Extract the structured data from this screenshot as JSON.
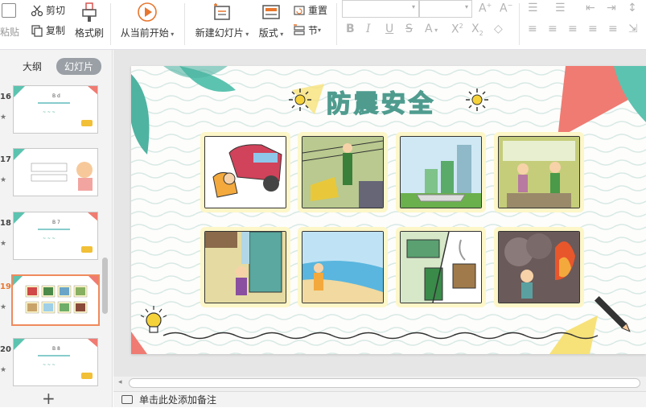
{
  "ribbon": {
    "paste_label": "粘贴",
    "cut_label": "剪切",
    "copy_label": "复制",
    "format_painter_label": "格式刷",
    "play_from_current_label": "从当前开始",
    "new_slide_label": "新建幻灯片",
    "layout_label": "版式",
    "reset_label": "重置",
    "section_label": "节"
  },
  "left_panel": {
    "tabs": [
      {
        "label": "大纲"
      },
      {
        "label": "幻灯片"
      }
    ],
    "slides": [
      {
        "number": "16",
        "star": "★"
      },
      {
        "number": "17",
        "star": "★"
      },
      {
        "number": "18",
        "star": "★"
      },
      {
        "number": "19",
        "star": "★"
      },
      {
        "number": "20",
        "star": "★"
      }
    ],
    "add_slide": "+"
  },
  "slide": {
    "title": "防震安全"
  },
  "notes": {
    "placeholder": "单击此处添加备注"
  },
  "colors": {
    "accent_orange": "#e8762c",
    "teal": "#4f9c8f",
    "coral": "#ef7b72"
  }
}
